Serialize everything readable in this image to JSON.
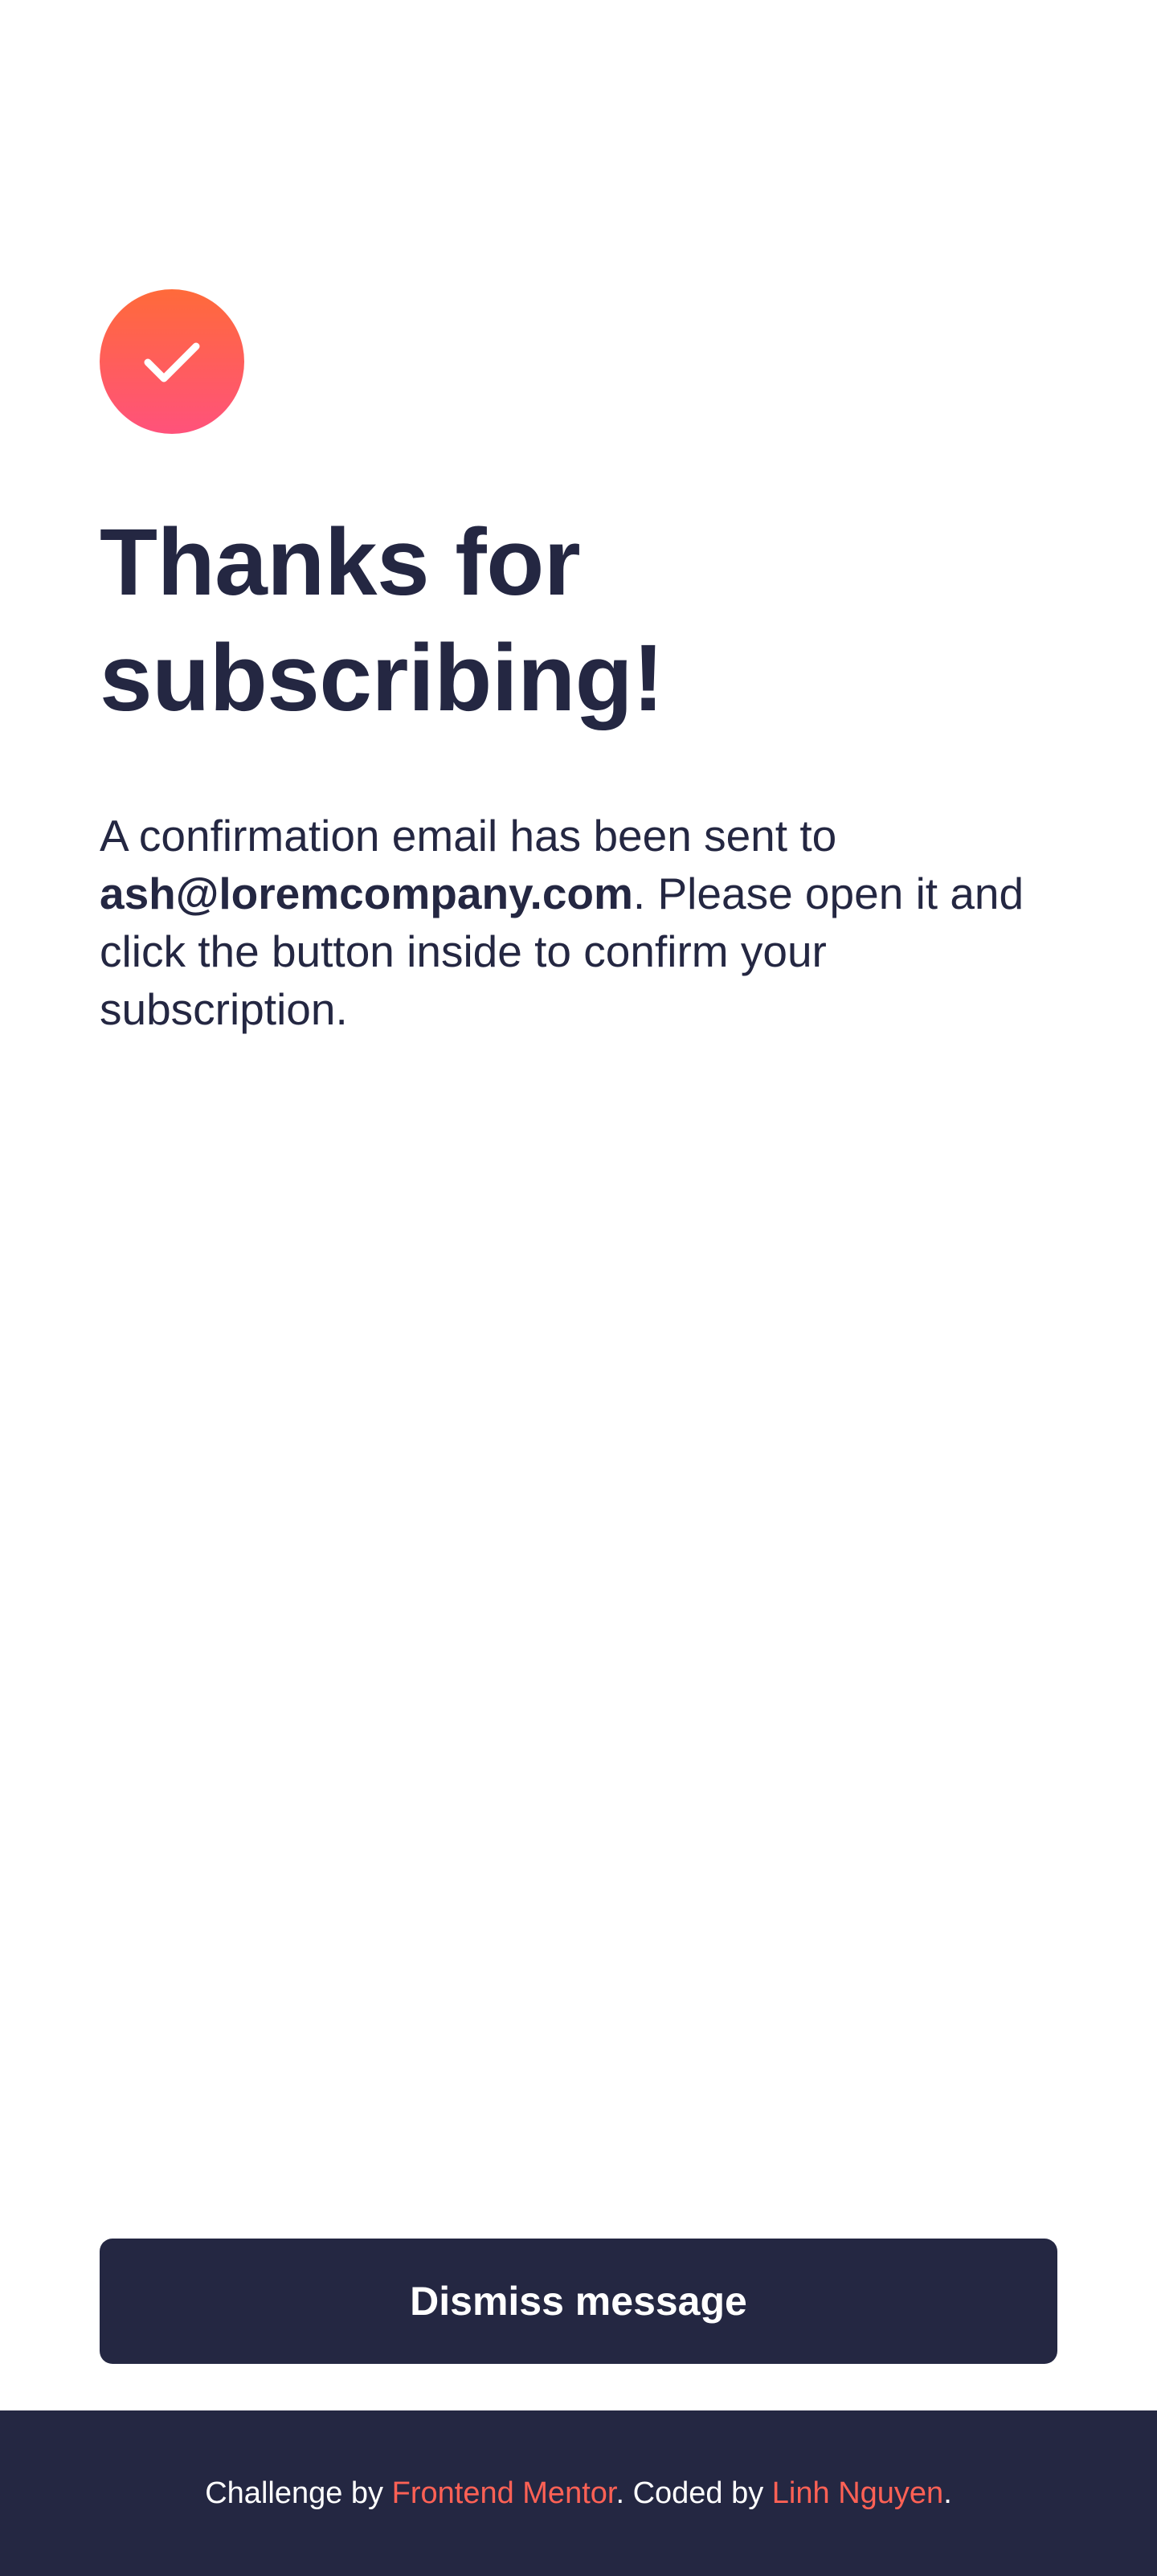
{
  "app": {
    "success_icon": "checkmark-icon",
    "accent": "#ff6155",
    "dark": "#242742"
  },
  "main": {
    "title": "Thanks for subscribing!",
    "message_prefix": "A confirmation email has been sent to ",
    "email": "ash@loremcompany.com",
    "message_suffix": ". Please open it and click the button inside to confirm your subscription.",
    "dismiss_label": "Dismiss message"
  },
  "footer": {
    "challenge_by": "Challenge by ",
    "frontend_mentor": "Frontend Mentor",
    "coded_by": ". Coded by ",
    "author": "Linh Nguyen",
    "period": "."
  }
}
